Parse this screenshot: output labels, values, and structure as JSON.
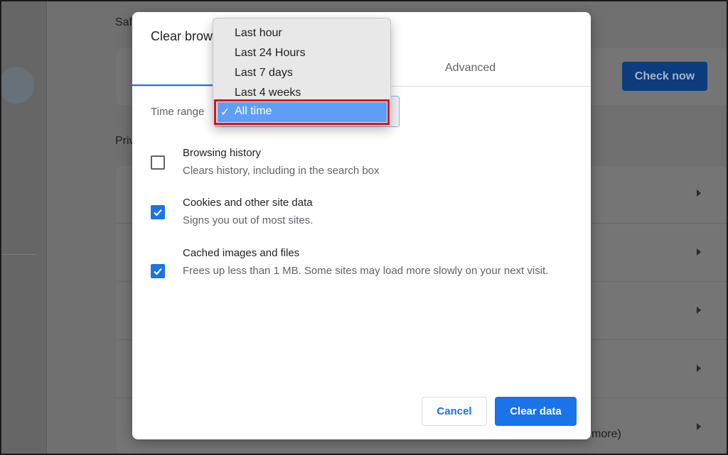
{
  "background": {
    "safety_heading_partial": "Saf",
    "privacy_heading_partial": "Priv",
    "check_now_label": "Check now",
    "more_partial": "more)"
  },
  "dialog": {
    "title_partial": "Clear brow",
    "tabs": {
      "advanced": "Advanced"
    },
    "time_range_label": "Time range",
    "items": [
      {
        "title": "Browsing history",
        "subtitle": "Clears history, including in the search box",
        "checked": false
      },
      {
        "title": "Cookies and other site data",
        "subtitle": "Signs you out of most sites.",
        "checked": true
      },
      {
        "title": "Cached images and files",
        "subtitle": "Frees up less than 1 MB. Some sites may load more slowly on your next visit.",
        "checked": true
      }
    ],
    "cancel_label": "Cancel",
    "clear_label": "Clear data"
  },
  "dropdown": {
    "options": [
      "Last hour",
      "Last 24 Hours",
      "Last 7 days",
      "Last 4 weeks"
    ],
    "selected": "All time",
    "check_mark": "✓"
  },
  "colors": {
    "accent": "#1a73e8",
    "highlight": "#e01010",
    "dropdown_selected": "#5e9ef7"
  }
}
